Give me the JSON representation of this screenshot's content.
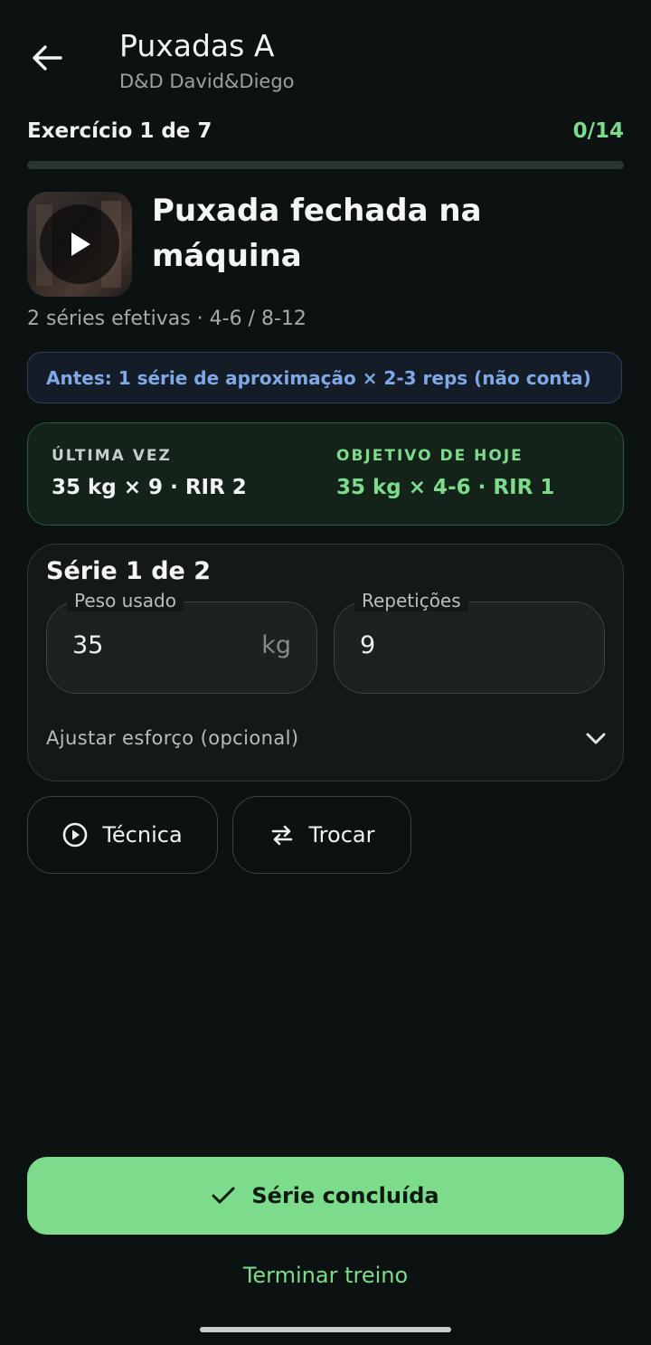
{
  "header": {
    "title": "Puxadas A",
    "subtitle": "D&D David&Diego"
  },
  "progress": {
    "label": "Exercício 1 de 7",
    "count": "0/14",
    "fraction": 0
  },
  "exercise": {
    "name": "Puxada fechada na máquina",
    "sets_info": "2 séries efetivas · 4-6 / 8-12",
    "thumbnail_icon": "play-icon"
  },
  "note": {
    "text": "Antes: 1 série de aproximação × 2-3 reps (não conta)"
  },
  "comparison": {
    "last_label": "ÚLTIMA VEZ",
    "last_value": "35 kg × 9 · RIR 2",
    "goal_label": "OBJETIVO DE HOJE",
    "goal_value": "35 kg × 4-6 · RIR 1"
  },
  "set_card": {
    "title": "Série 1 de 2",
    "weight_label": "Peso usado",
    "weight_value": "35",
    "weight_unit": "kg",
    "reps_label": "Repetições",
    "reps_value": "9",
    "effort_label": "Ajustar esforço (opcional)"
  },
  "actions": {
    "technique_label": "Técnica",
    "swap_label": "Trocar"
  },
  "primary_button": {
    "label": "Série concluída"
  },
  "finish_link": {
    "label": "Terminar treino"
  },
  "colors": {
    "accent": "#7ddc8b",
    "background": "#0c1211",
    "note_text": "#7fa8e6"
  }
}
